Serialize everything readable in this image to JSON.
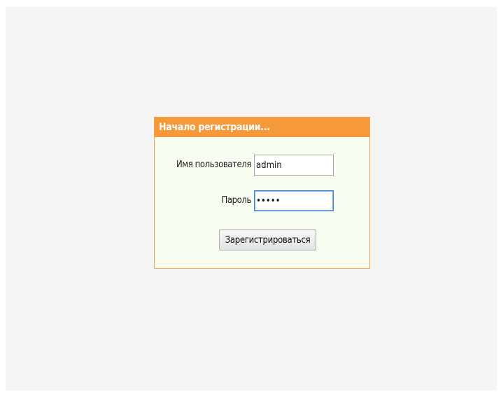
{
  "login": {
    "title": "Начало регистрации...",
    "username_label": "Имя пользователя",
    "username_value": "admin",
    "password_label": "Пароль",
    "password_value": "•••••",
    "submit_label": "Зарегистрироваться"
  },
  "colors": {
    "header_bg": "#f5993a",
    "panel_border": "#f6a24a",
    "panel_bg": "#f7fdf1",
    "page_bg": "#f5f5f5",
    "focus_border": "#3b7fd9"
  }
}
